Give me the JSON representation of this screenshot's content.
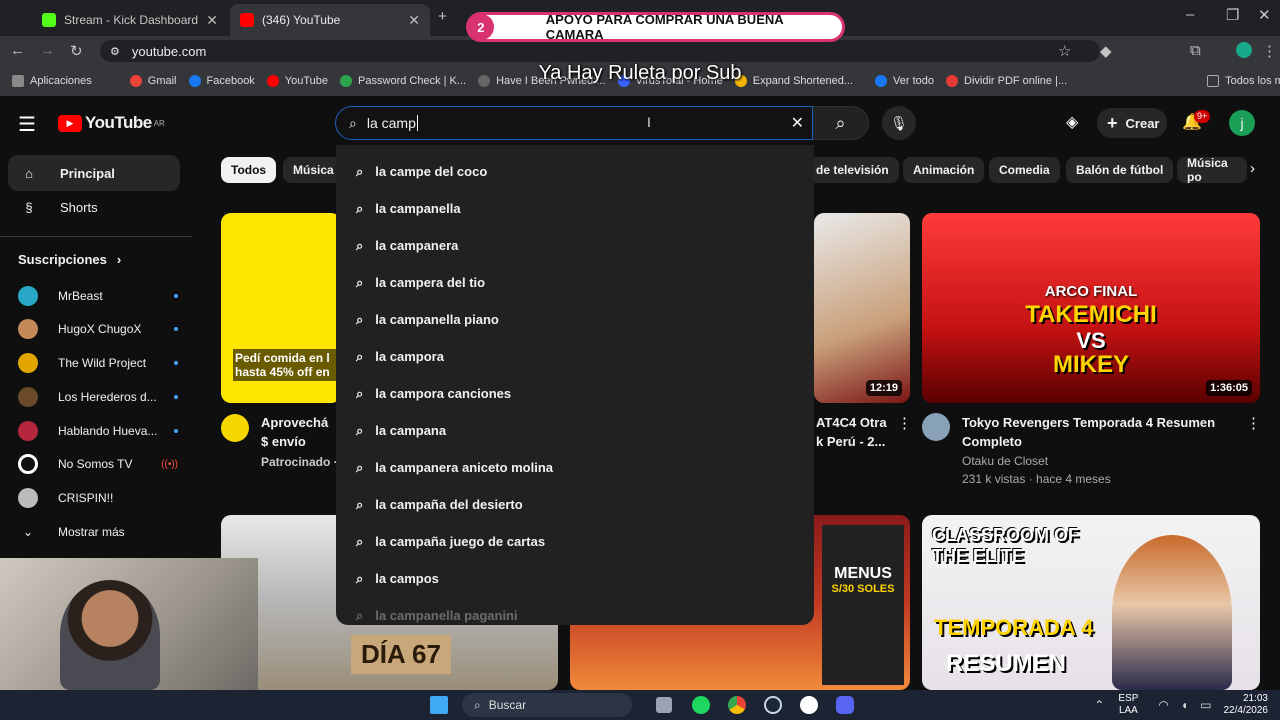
{
  "browser": {
    "tabs": [
      {
        "title": "Stream - Kick Dashboard",
        "color": "#53fc18"
      },
      {
        "title": "(346) YouTube",
        "color": "#ff0000"
      }
    ],
    "url": "youtube.com",
    "bookmarks": [
      "Aplicaciones",
      "Gmail",
      "Facebook",
      "YouTube",
      "Password Check | K...",
      "Have I Been Pwned:...",
      "VirusTotal - Home",
      "Expand Shortened...",
      "Ver todo",
      "Dividir PDF online |..."
    ],
    "all_bookmarks": "Todos los marcadores"
  },
  "overlay": {
    "donation_count": "2",
    "donation_text": "APOYO PARA COMPRAR UNA BUENA CAMARA",
    "ruleta_text": "Ya Hay Ruleta por Sub"
  },
  "youtube": {
    "logo": "YouTube",
    "country": "AR",
    "search_value": "la camp",
    "create_label": "Crear",
    "notif_badge": "9+",
    "avatar_letter": "j",
    "sidebar": {
      "home": "Principal",
      "shorts": "Shorts",
      "subs_header": "Suscripciones",
      "subs": [
        {
          "name": "MrBeast",
          "color": "#2aa6c6",
          "live": false
        },
        {
          "name": "HugoX ChugoX",
          "color": "#c48a57",
          "live": false
        },
        {
          "name": "The Wild Project",
          "color": "#e2a500",
          "live": false
        },
        {
          "name": "Los Herederos d...",
          "color": "#6b4a2a",
          "live": false
        },
        {
          "name": "Hablando Huevа...",
          "color": "#b5273f",
          "live": false
        },
        {
          "name": "No Somos TV",
          "color": "#ffffff",
          "live": true
        },
        {
          "name": "CRISPIN!!",
          "color": "#bbbbbb",
          "live": false
        }
      ],
      "show_more": "Mostrar más"
    },
    "chips": [
      "Todos",
      "Música",
      "de televisión",
      "Animación",
      "Comedia",
      "Balón de fútbol",
      "Música po"
    ],
    "suggestions": [
      "la campe del coco",
      "la campanella",
      "la campanera",
      "la campera del tio",
      "la campanella piano",
      "la campora",
      "la campora canciones",
      "la campana",
      "la campanera aniceto molina",
      "la campaña del desierto",
      "la campaña juego de cartas",
      "la campos",
      "la campanella paganini"
    ],
    "videos": {
      "ad_overlay": "Pedí comida en l hasta 45% off en",
      "ad_title": "Aprovechá $ envío gratis",
      "ad_sponsored": "Patrocinado ·",
      "v2_duration": "12:19",
      "v2_title": "AT4C4 Otra k Perú - 2...",
      "v3_duration": "1:36:05",
      "v3_title": "Tokyo Revengers Temporada 4 Resumen Completo",
      "v3_channel": "Otaku de Closet",
      "v3_meta": "231 k vistas · hace 4 meses",
      "v3_thumb_line1": "ARCO FINAL",
      "v3_thumb_line2": "TAKEMICHI",
      "v3_thumb_line3": "VS",
      "v3_thumb_line4": "MIKEY",
      "row2_a_text": "DÍA 67",
      "row2_c_text1": "MENUS",
      "row2_c_text2": "S/30 SOLES",
      "row2_d_text1": "CLASSROOM OF THE ELITE",
      "row2_d_text2": "TEMPORADA 4",
      "row2_d_text3": "RESUMEN"
    }
  },
  "taskbar": {
    "search": "Buscar",
    "lang": "ESP",
    "lang2": "LAA",
    "time": "21:03",
    "date": "22/4/2026"
  }
}
